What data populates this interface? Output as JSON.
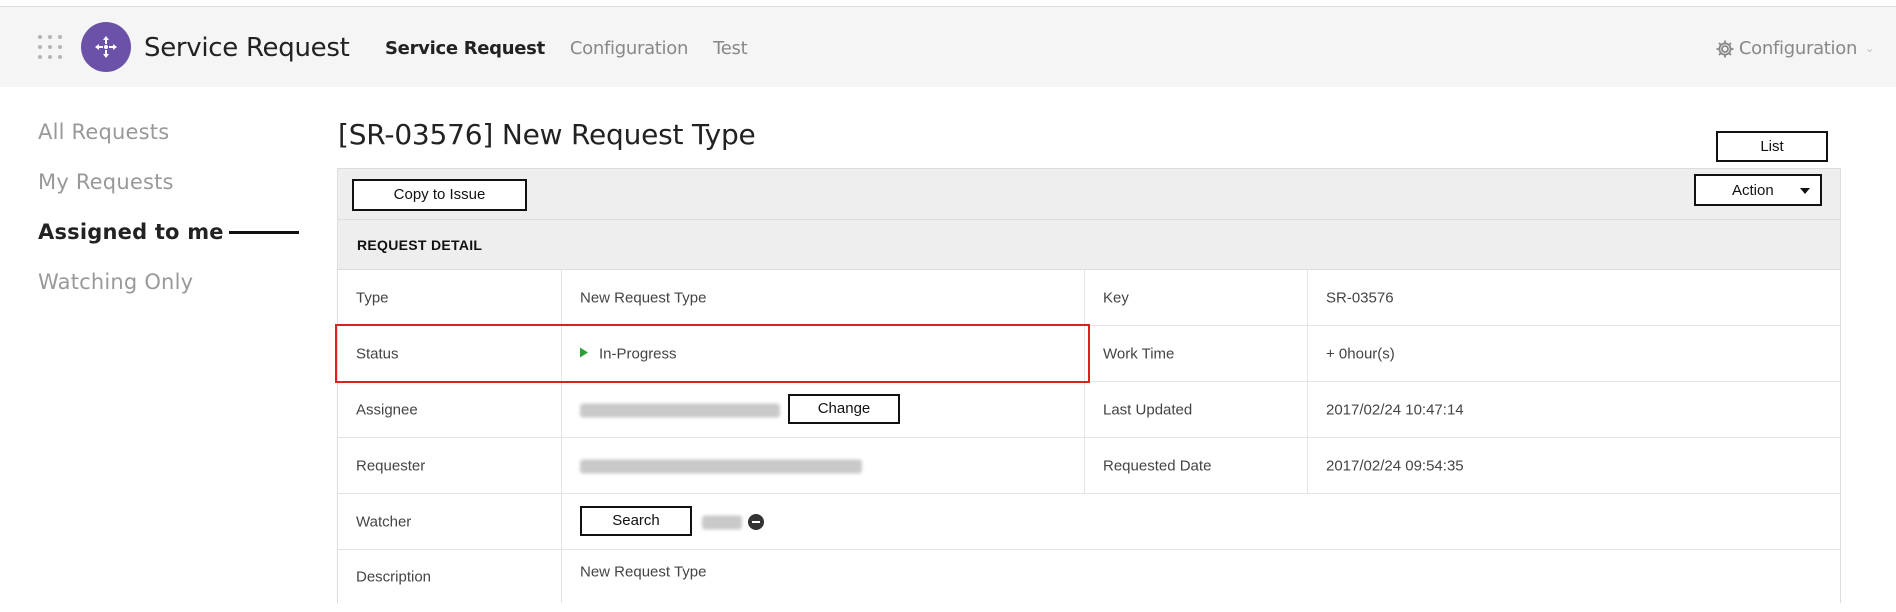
{
  "header": {
    "app_title": "Service Request",
    "nav": [
      "Service Request",
      "Configuration",
      "Test"
    ],
    "active_nav": "Service Request",
    "config_menu": "Configuration",
    "colors": {
      "logo": "#6b52a8",
      "background": "#f5f5f5"
    }
  },
  "sidebar": {
    "items": [
      {
        "label": "All Requests",
        "active": false
      },
      {
        "label": "My Requests",
        "active": false
      },
      {
        "label": "Assigned to me",
        "active": true
      },
      {
        "label": "Watching Only",
        "active": false
      }
    ]
  },
  "main": {
    "title": "[SR-03576] New Request Type",
    "list_button": "List",
    "copy_button": "Copy to Issue",
    "action_button": "Action",
    "section_title": "REQUEST DETAIL",
    "fields": {
      "type_label": "Type",
      "type_value": "New Request Type",
      "key_label": "Key",
      "key_value": "SR-03576",
      "status_label": "Status",
      "status_value": "In-Progress",
      "status_color": "#2e9e3a",
      "worktime_label": "Work Time",
      "worktime_value": "+ 0hour(s)",
      "assignee_label": "Assignee",
      "assignee_change_button": "Change",
      "lastupdated_label": "Last Updated",
      "lastupdated_value": "2017/02/24 10:47:14",
      "requester_label": "Requester",
      "requesteddate_label": "Requested Date",
      "requesteddate_value": "2017/02/24 09:54:35",
      "watcher_label": "Watcher",
      "watcher_search_button": "Search",
      "description_label": "Description",
      "description_value": "New Request Type"
    },
    "highlight_color": "#e02020"
  }
}
